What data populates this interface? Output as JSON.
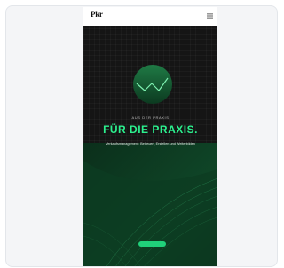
{
  "site": {
    "logo_text": "Pkr",
    "menu_icon": "hamburger-menu-icon"
  },
  "hero": {
    "eyebrow": "AUS DER PRAXIS",
    "headline": "FÜR DIE PRAXIS.",
    "subline": "Verkaufsmanagement: Betreuen, Erstellen und Weiterbilden",
    "cta_label": "",
    "emblem_icon": "chart-line-circle-icon"
  },
  "colors": {
    "accent": "#2cf08e",
    "background": "#151515",
    "deep_green": "#0e3a22"
  }
}
